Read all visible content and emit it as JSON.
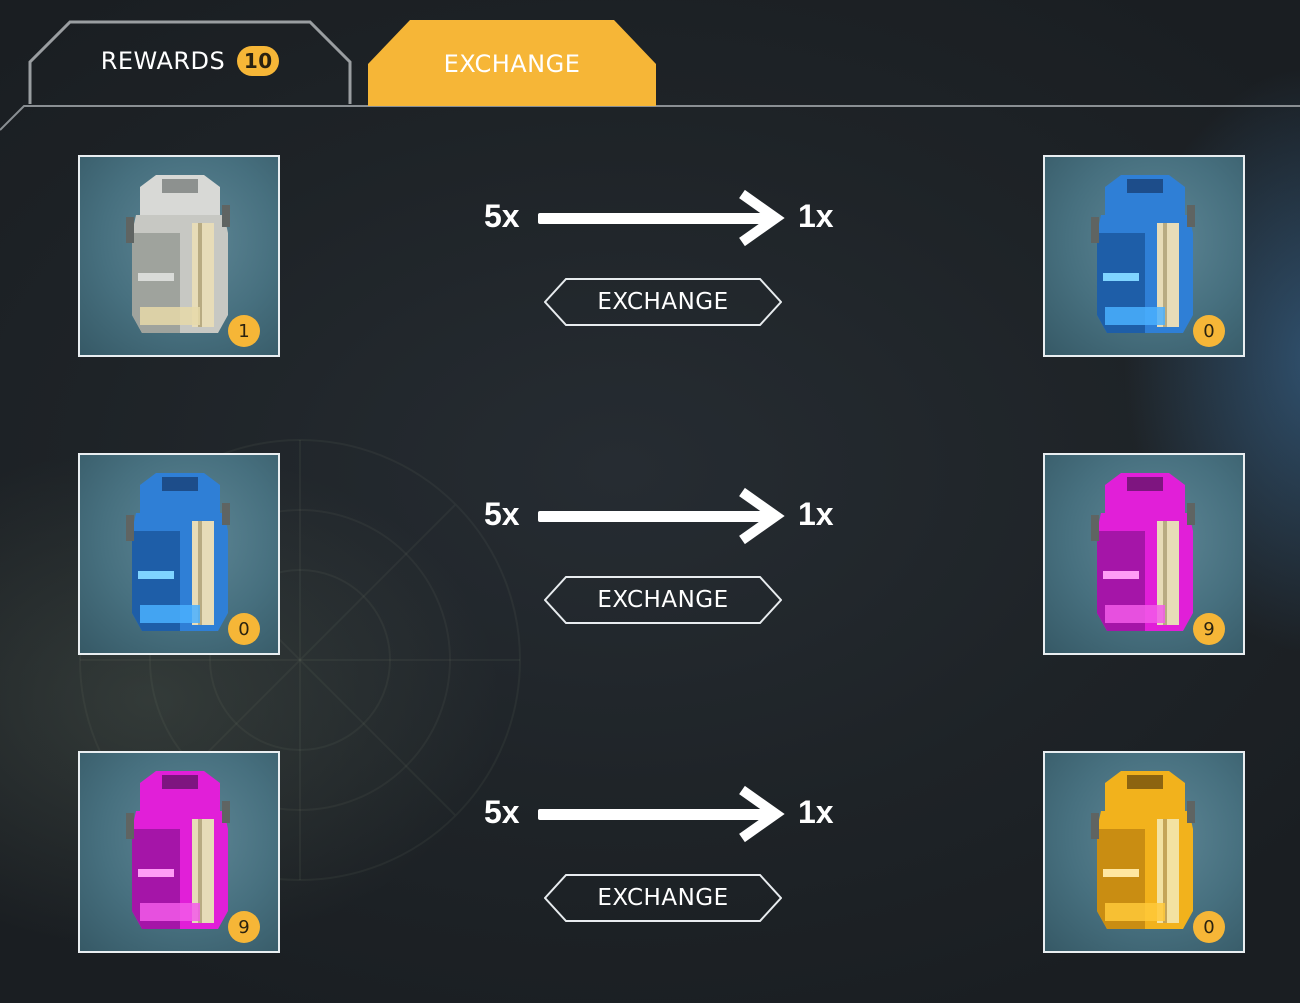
{
  "tabs": {
    "rewards_label": "REWARDS",
    "rewards_badge": "10",
    "exchange_label": "EXCHANGE",
    "active": "exchange"
  },
  "colors": {
    "accent": "#f6b637",
    "tab_active": "#f6b637",
    "tier_silver": "#c9ccc8",
    "tier_blue": "#2f7fd6",
    "tier_magenta": "#e11fd8",
    "tier_gold": "#f2b21c"
  },
  "exchanges": [
    {
      "from_qty": "5x",
      "to_qty": "1x",
      "button": "EXCHANGE",
      "from_item": {
        "tier": "silver",
        "icon": "silver-crate-icon",
        "count": "1"
      },
      "to_item": {
        "tier": "blue",
        "icon": "blue-crate-icon",
        "count": "0"
      }
    },
    {
      "from_qty": "5x",
      "to_qty": "1x",
      "button": "EXCHANGE",
      "from_item": {
        "tier": "blue",
        "icon": "blue-crate-icon",
        "count": "0"
      },
      "to_item": {
        "tier": "magenta",
        "icon": "magenta-crate-icon",
        "count": "9"
      }
    },
    {
      "from_qty": "5x",
      "to_qty": "1x",
      "button": "EXCHANGE",
      "from_item": {
        "tier": "magenta",
        "icon": "magenta-crate-icon",
        "count": "9"
      },
      "to_item": {
        "tier": "gold",
        "icon": "gold-crate-icon",
        "count": "0"
      }
    }
  ]
}
